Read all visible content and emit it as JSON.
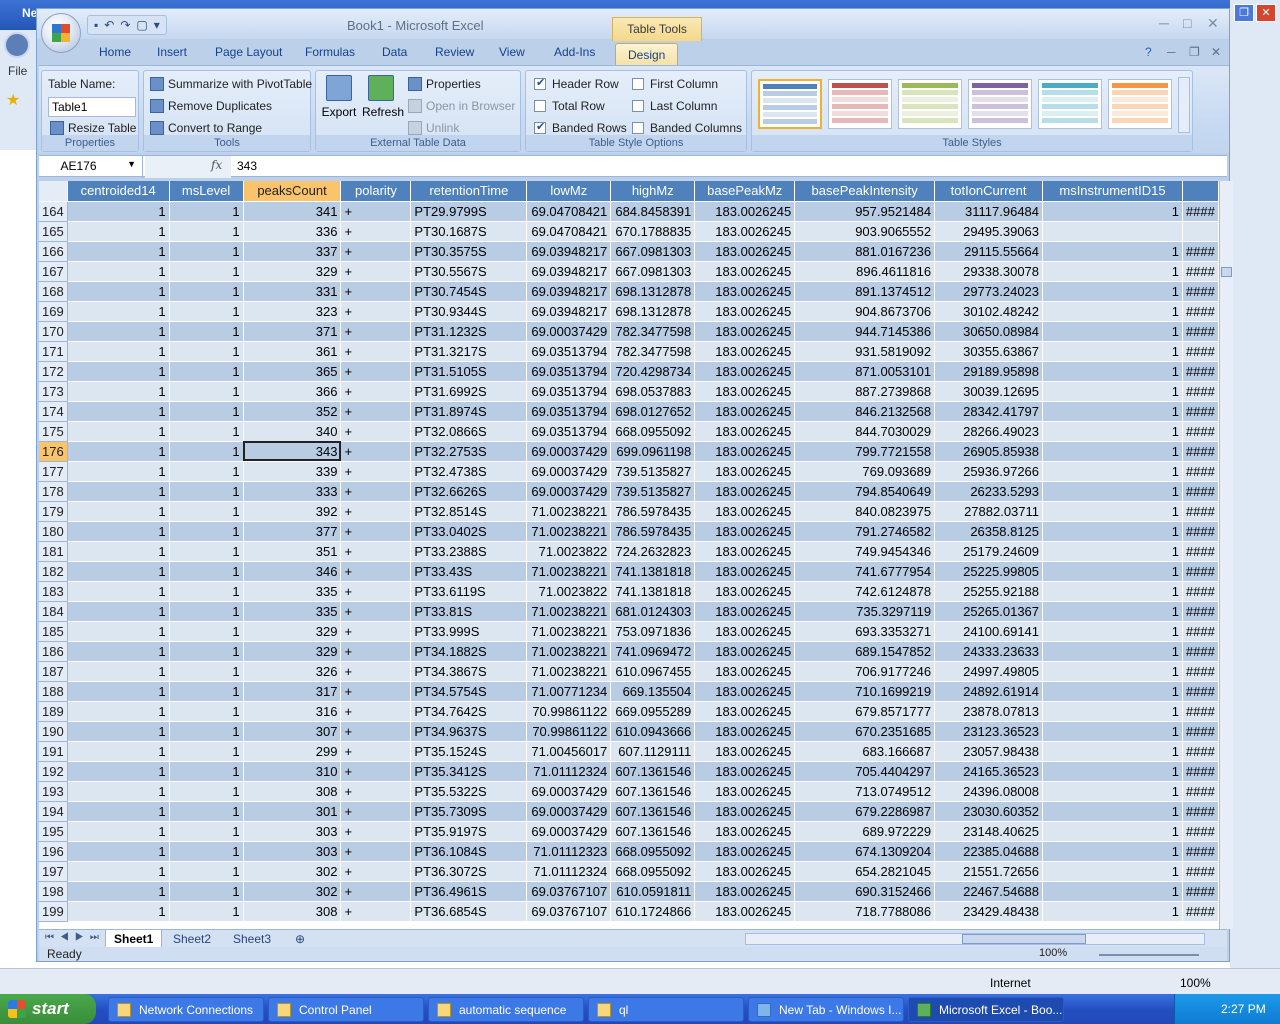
{
  "ie": {
    "title_partial": "Ne",
    "file_menu": "File",
    "fav_partial": "Fa",
    "zone": "Internet",
    "zoom": "100%"
  },
  "window": {
    "title": "Book1 - Microsoft Excel",
    "table_tools": "Table Tools"
  },
  "tabs": [
    "Home",
    "Insert",
    "Page Layout",
    "Formulas",
    "Data",
    "Review",
    "View",
    "Add-Ins",
    "Design"
  ],
  "ribbon": {
    "properties": {
      "label": "Properties",
      "table_name_label": "Table Name:",
      "table_name_value": "Table1",
      "resize": "Resize Table"
    },
    "tools": {
      "label": "Tools",
      "pivot": "Summarize with PivotTable",
      "remove_dup": "Remove Duplicates",
      "convert": "Convert to Range"
    },
    "external": {
      "label": "External Table Data",
      "export": "Export",
      "refresh": "Refresh",
      "properties": "Properties",
      "open_browser": "Open in Browser",
      "unlink": "Unlink"
    },
    "style_options": {
      "label": "Table Style Options",
      "header_row": "Header Row",
      "total_row": "Total Row",
      "banded_rows": "Banded Rows",
      "first_column": "First Column",
      "last_column": "Last Column",
      "banded_columns": "Banded Columns"
    },
    "styles": {
      "label": "Table Styles",
      "colors": [
        "#4f81bd",
        "#c0504d",
        "#9bbb59",
        "#8064a2",
        "#4bacc6",
        "#f79646"
      ]
    }
  },
  "formula_bar": {
    "name_box": "AE176",
    "fx": "fx",
    "value": "343"
  },
  "headers": [
    "centroided14",
    "msLevel",
    "peaksCount",
    "polarity",
    "retentionTime",
    "lowMz",
    "highMz",
    "basePeakMz",
    "basePeakIntensity",
    "totIonCurrent",
    "msInstrumentID15",
    ""
  ],
  "rows": [
    [
      "164",
      "1",
      "1",
      "341",
      "+",
      "PT29.9799S",
      "69.04708421",
      "684.8458391",
      "183.0026245",
      "957.9521484",
      "31117.96484",
      "1",
      "####"
    ],
    [
      "165",
      "1",
      "1",
      "336",
      "+",
      "PT30.1687S",
      "69.04708421",
      "670.1788835",
      "183.0026245",
      "903.9065552",
      "29495.39063",
      "",
      ""
    ],
    [
      "166",
      "1",
      "1",
      "337",
      "+",
      "PT30.3575S",
      "69.03948217",
      "667.0981303",
      "183.0026245",
      "881.0167236",
      "29115.55664",
      "1",
      "####"
    ],
    [
      "167",
      "1",
      "1",
      "329",
      "+",
      "PT30.5567S",
      "69.03948217",
      "667.0981303",
      "183.0026245",
      "896.4611816",
      "29338.30078",
      "1",
      "####"
    ],
    [
      "168",
      "1",
      "1",
      "331",
      "+",
      "PT30.7454S",
      "69.03948217",
      "698.1312878",
      "183.0026245",
      "891.1374512",
      "29773.24023",
      "1",
      "####"
    ],
    [
      "169",
      "1",
      "1",
      "323",
      "+",
      "PT30.9344S",
      "69.03948217",
      "698.1312878",
      "183.0026245",
      "904.8673706",
      "30102.48242",
      "1",
      "####"
    ],
    [
      "170",
      "1",
      "1",
      "371",
      "+",
      "PT31.1232S",
      "69.00037429",
      "782.3477598",
      "183.0026245",
      "944.7145386",
      "30650.08984",
      "1",
      "####"
    ],
    [
      "171",
      "1",
      "1",
      "361",
      "+",
      "PT31.3217S",
      "69.03513794",
      "782.3477598",
      "183.0026245",
      "931.5819092",
      "30355.63867",
      "1",
      "####"
    ],
    [
      "172",
      "1",
      "1",
      "365",
      "+",
      "PT31.5105S",
      "69.03513794",
      "720.4298734",
      "183.0026245",
      "871.0053101",
      "29189.95898",
      "1",
      "####"
    ],
    [
      "173",
      "1",
      "1",
      "366",
      "+",
      "PT31.6992S",
      "69.03513794",
      "698.0537883",
      "183.0026245",
      "887.2739868",
      "30039.12695",
      "1",
      "####"
    ],
    [
      "174",
      "1",
      "1",
      "352",
      "+",
      "PT31.8974S",
      "69.03513794",
      "698.0127652",
      "183.0026245",
      "846.2132568",
      "28342.41797",
      "1",
      "####"
    ],
    [
      "175",
      "1",
      "1",
      "340",
      "+",
      "PT32.0866S",
      "69.03513794",
      "668.0955092",
      "183.0026245",
      "844.7030029",
      "28266.49023",
      "1",
      "####"
    ],
    [
      "176",
      "1",
      "1",
      "343",
      "+",
      "PT32.2753S",
      "69.00037429",
      "699.0961198",
      "183.0026245",
      "799.7721558",
      "26905.85938",
      "1",
      "####"
    ],
    [
      "177",
      "1",
      "1",
      "339",
      "+",
      "PT32.4738S",
      "69.00037429",
      "739.5135827",
      "183.0026245",
      "769.093689",
      "25936.97266",
      "1",
      "####"
    ],
    [
      "178",
      "1",
      "1",
      "333",
      "+",
      "PT32.6626S",
      "69.00037429",
      "739.5135827",
      "183.0026245",
      "794.8540649",
      "26233.5293",
      "1",
      "####"
    ],
    [
      "179",
      "1",
      "1",
      "392",
      "+",
      "PT32.8514S",
      "71.00238221",
      "786.5978435",
      "183.0026245",
      "840.0823975",
      "27882.03711",
      "1",
      "####"
    ],
    [
      "180",
      "1",
      "1",
      "377",
      "+",
      "PT33.0402S",
      "71.00238221",
      "786.5978435",
      "183.0026245",
      "791.2746582",
      "26358.8125",
      "1",
      "####"
    ],
    [
      "181",
      "1",
      "1",
      "351",
      "+",
      "PT33.2388S",
      "71.0023822",
      "724.2632823",
      "183.0026245",
      "749.9454346",
      "25179.24609",
      "1",
      "####"
    ],
    [
      "182",
      "1",
      "1",
      "346",
      "+",
      "PT33.43S",
      "71.00238221",
      "741.1381818",
      "183.0026245",
      "741.6777954",
      "25225.99805",
      "1",
      "####"
    ],
    [
      "183",
      "1",
      "1",
      "335",
      "+",
      "PT33.6119S",
      "71.0023822",
      "741.1381818",
      "183.0026245",
      "742.6124878",
      "25255.92188",
      "1",
      "####"
    ],
    [
      "184",
      "1",
      "1",
      "335",
      "+",
      "PT33.81S",
      "71.00238221",
      "681.0124303",
      "183.0026245",
      "735.3297119",
      "25265.01367",
      "1",
      "####"
    ],
    [
      "185",
      "1",
      "1",
      "329",
      "+",
      "PT33.999S",
      "71.00238221",
      "753.0971836",
      "183.0026245",
      "693.3353271",
      "24100.69141",
      "1",
      "####"
    ],
    [
      "186",
      "1",
      "1",
      "329",
      "+",
      "PT34.1882S",
      "71.00238221",
      "741.0969472",
      "183.0026245",
      "689.1547852",
      "24333.23633",
      "1",
      "####"
    ],
    [
      "187",
      "1",
      "1",
      "326",
      "+",
      "PT34.3867S",
      "71.00238221",
      "610.0967455",
      "183.0026245",
      "706.9177246",
      "24997.49805",
      "1",
      "####"
    ],
    [
      "188",
      "1",
      "1",
      "317",
      "+",
      "PT34.5754S",
      "71.00771234",
      "669.135504",
      "183.0026245",
      "710.1699219",
      "24892.61914",
      "1",
      "####"
    ],
    [
      "189",
      "1",
      "1",
      "316",
      "+",
      "PT34.7642S",
      "70.99861122",
      "669.0955289",
      "183.0026245",
      "679.8571777",
      "23878.07813",
      "1",
      "####"
    ],
    [
      "190",
      "1",
      "1",
      "307",
      "+",
      "PT34.9637S",
      "70.99861122",
      "610.0943666",
      "183.0026245",
      "670.2351685",
      "23123.36523",
      "1",
      "####"
    ],
    [
      "191",
      "1",
      "1",
      "299",
      "+",
      "PT35.1524S",
      "71.00456017",
      "607.1129111",
      "183.0026245",
      "683.166687",
      "23057.98438",
      "1",
      "####"
    ],
    [
      "192",
      "1",
      "1",
      "310",
      "+",
      "PT35.3412S",
      "71.01112324",
      "607.1361546",
      "183.0026245",
      "705.4404297",
      "24165.36523",
      "1",
      "####"
    ],
    [
      "193",
      "1",
      "1",
      "308",
      "+",
      "PT35.5322S",
      "69.00037429",
      "607.1361546",
      "183.0026245",
      "713.0749512",
      "24396.08008",
      "1",
      "####"
    ],
    [
      "194",
      "1",
      "1",
      "301",
      "+",
      "PT35.7309S",
      "69.00037429",
      "607.1361546",
      "183.0026245",
      "679.2286987",
      "23030.60352",
      "1",
      "####"
    ],
    [
      "195",
      "1",
      "1",
      "303",
      "+",
      "PT35.9197S",
      "69.00037429",
      "607.1361546",
      "183.0026245",
      "689.972229",
      "23148.40625",
      "1",
      "####"
    ],
    [
      "196",
      "1",
      "1",
      "303",
      "+",
      "PT36.1084S",
      "71.01112323",
      "668.0955092",
      "183.0026245",
      "674.1309204",
      "22385.04688",
      "1",
      "####"
    ],
    [
      "197",
      "1",
      "1",
      "302",
      "+",
      "PT36.3072S",
      "71.01112324",
      "668.0955092",
      "183.0026245",
      "654.2821045",
      "21551.72656",
      "1",
      "####"
    ],
    [
      "198",
      "1",
      "1",
      "302",
      "+",
      "PT36.4961S",
      "69.03767107",
      "610.0591811",
      "183.0026245",
      "690.3152466",
      "22467.54688",
      "1",
      "####"
    ],
    [
      "199",
      "1",
      "1",
      "308",
      "+",
      "PT36.6854S",
      "69.03767107",
      "610.1724866",
      "183.0026245",
      "718.7788086",
      "23429.48438",
      "1",
      "####"
    ]
  ],
  "sheets": [
    "Sheet1",
    "Sheet2",
    "Sheet3"
  ],
  "status": {
    "ready": "Ready",
    "zoom": "100%"
  },
  "taskbar": {
    "start": "start",
    "items": [
      "Network Connections",
      "Control Panel",
      "automatic sequence",
      "ql",
      "New Tab - Windows I...",
      "Microsoft Excel - Boo..."
    ],
    "clock": "2:27 PM"
  }
}
